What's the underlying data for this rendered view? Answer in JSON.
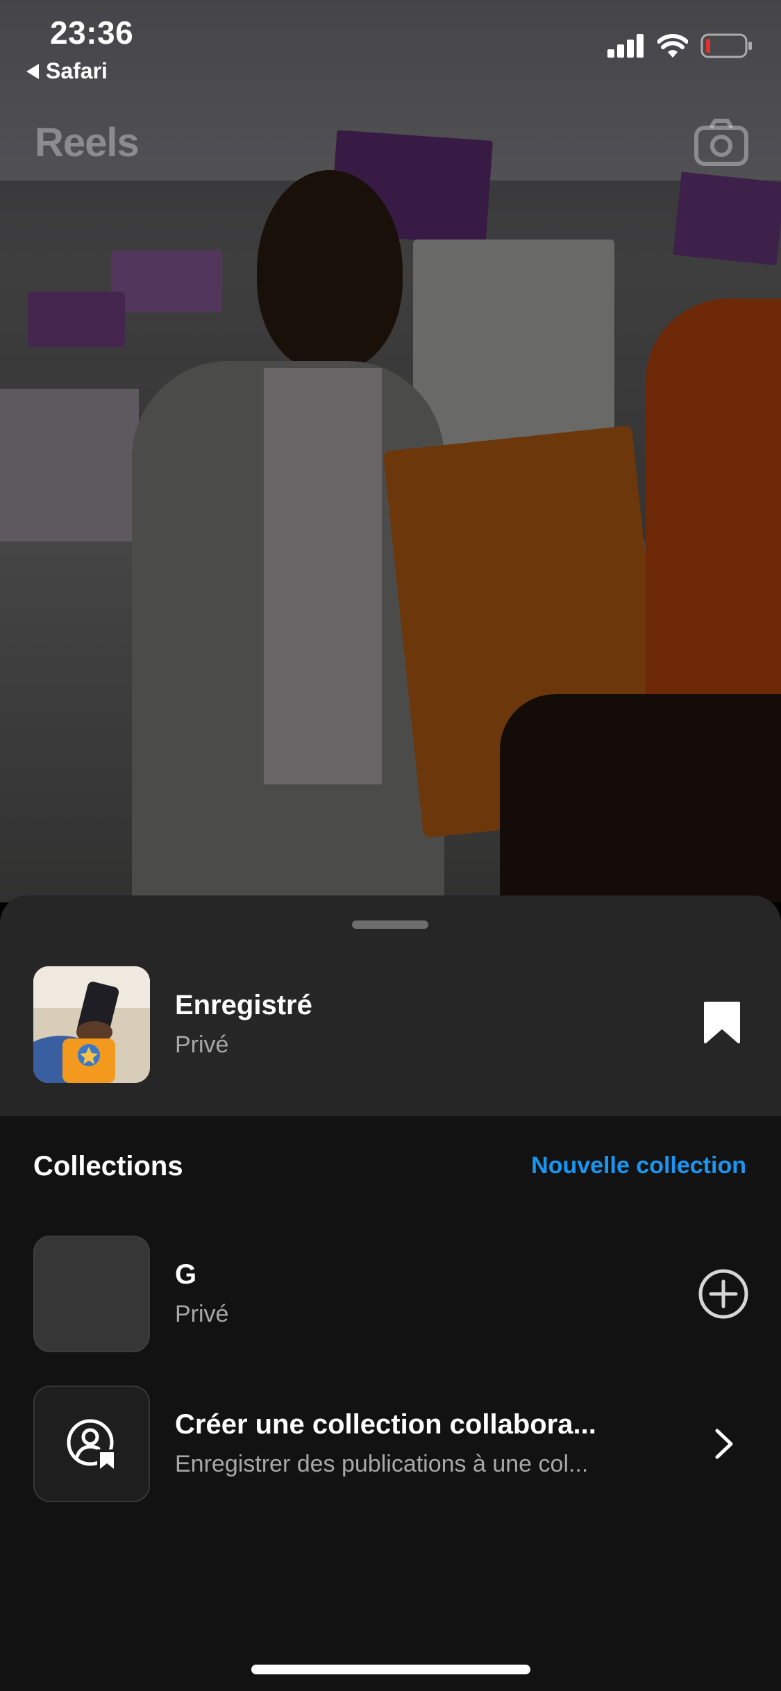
{
  "status_bar": {
    "time": "23:36",
    "back_app": "Safari",
    "icons": [
      "cellular-signal-icon",
      "wifi-icon",
      "battery-low-icon"
    ],
    "battery_color": "#e0312f"
  },
  "reel": {
    "title": "Reels",
    "camera_icon": "camera-icon"
  },
  "sheet": {
    "saved": {
      "title": "Enregistré",
      "subtitle": "Privé",
      "icon": "bookmark-filled-icon"
    },
    "collections": {
      "heading": "Collections",
      "new_collection": "Nouvelle collection",
      "items": [
        {
          "title": "G",
          "subtitle": "Privé",
          "action_icon": "add-circle-icon"
        },
        {
          "title": "Créer une collection collabora...",
          "subtitle": "Enregistrer des publications à une col...",
          "icon": "collab-user-bookmark-icon",
          "action_icon": "chevron-right-icon"
        }
      ]
    }
  },
  "colors": {
    "sheet_background": "#121212",
    "sheet_header_background": "#262626",
    "accent_link": "#1a95f0",
    "secondary_text": "#a8a8a8"
  }
}
